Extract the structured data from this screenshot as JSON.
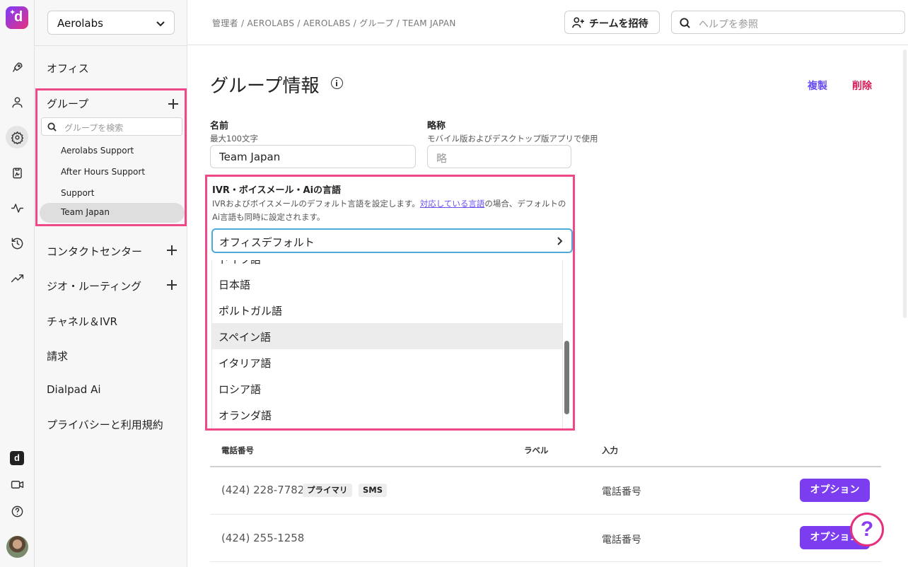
{
  "rail": {
    "logo_text": "d",
    "icons": [
      "rocket-icon",
      "user-icon",
      "gear-icon",
      "clipboard-icon",
      "activity-icon",
      "history-icon",
      "trending-icon",
      "dialpad-app-icon",
      "video-icon",
      "help-icon",
      "avatar"
    ],
    "app_text": "d"
  },
  "sidebar": {
    "org": "Aerolabs",
    "office": "オフィス",
    "groups": {
      "label": "グループ",
      "search_placeholder": "グループを検索",
      "items": [
        "Aerolabs Support",
        "After Hours Support",
        "Support",
        "Team Japan"
      ],
      "selected": "Team Japan"
    },
    "contact_center": "コンタクトセンター",
    "geo_routing": "ジオ・ルーティング",
    "channels": "チャネル＆IVR",
    "billing": "請求",
    "dialpad_ai": "Dialpad Ai",
    "privacy": "プライバシーと利用規約"
  },
  "topbar": {
    "breadcrumb": "管理者 / AEROLABS / AEROLABS / グループ / TEAM JAPAN",
    "invite_label": "チームを招待",
    "help_placeholder": "ヘルプを参照"
  },
  "main": {
    "title": "グループ情報",
    "duplicate": "複製",
    "delete": "削除",
    "name_label": "名前",
    "name_hint": "最大100文字",
    "name_value": "Team Japan",
    "abbr_label": "略称",
    "abbr_hint": "モバイル版およびデスクトップ版アプリで使用",
    "abbr_placeholder": "略",
    "language": {
      "label": "IVR・ボイスメール・Aiの言語",
      "desc_before": "IVRおよびボイスメールのデフォルト言語を設定します。",
      "desc_link": "対応している言語",
      "desc_after": "の場合、デフォルトのAi言語も同時に設定されます。",
      "selected": "オフィスデフォルト",
      "partial_option": "ドイツ語",
      "options": [
        "日本語",
        "ポルトガル語",
        "スペイン語",
        "イタリア語",
        "ロシア語",
        "オランダ語"
      ],
      "highlighted": "スペイン語"
    },
    "table": {
      "headers": [
        "電話番号",
        "ラベル",
        "入力"
      ],
      "rows": [
        {
          "number": "(424) 228-7782",
          "badges": [
            "プライマリ",
            "SMS"
          ],
          "input": "電話番号",
          "action": "オプション"
        },
        {
          "number": "(424) 255-1258",
          "badges": [],
          "input": "電話番号",
          "action": "オプション"
        }
      ]
    },
    "help_fab": "?"
  },
  "colors": {
    "accent": "#7c3cf0",
    "link": "#6b4ef0",
    "danger": "#d41b55",
    "highlight_box": "#f0498a",
    "focus": "#4ea9dc"
  }
}
